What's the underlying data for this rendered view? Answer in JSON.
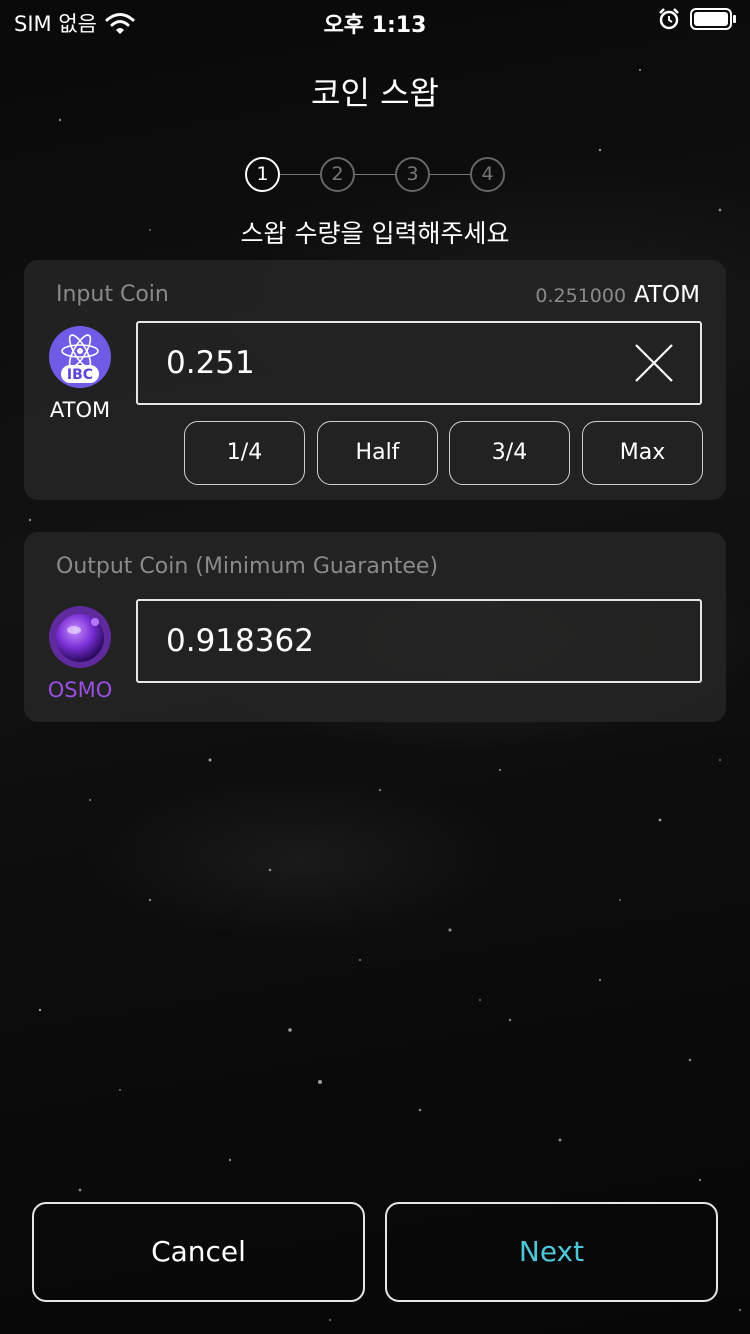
{
  "status_bar": {
    "carrier": "SIM 없음",
    "time": "오후 1:13"
  },
  "header": {
    "title": "코인 스왑"
  },
  "steps": [
    "1",
    "2",
    "3",
    "4"
  ],
  "instruction": "스왑 수량을 입력해주세요",
  "input_card": {
    "label": "Input Coin",
    "balance_amount": "0.251000",
    "balance_symbol": "ATOM",
    "coin_name": "ATOM",
    "coin_badge": "IBC",
    "amount": "0.251",
    "quick_buttons": [
      "1/4",
      "Half",
      "3/4",
      "Max"
    ]
  },
  "output_card": {
    "label": "Output Coin (Minimum Guarantee)",
    "coin_name": "OSMO",
    "amount": "0.918362"
  },
  "buttons": {
    "cancel": "Cancel",
    "next": "Next"
  },
  "colors": {
    "accent_next": "#4fc6d8",
    "osmo_purple": "#9a4fe0",
    "ibc_purple": "#6f5be6"
  },
  "icons": [
    "wifi-icon",
    "alarm-icon",
    "battery-icon",
    "close-icon",
    "atom-ibc-logo",
    "osmo-logo"
  ]
}
